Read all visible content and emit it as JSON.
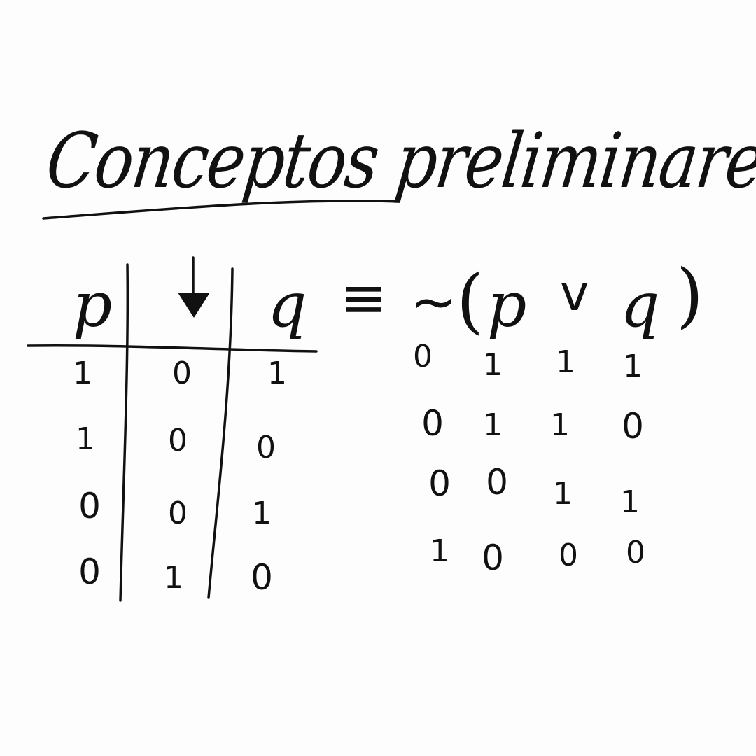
{
  "title": "Conceptos preliminares",
  "truth_table": {
    "headers": [
      "p",
      "↓",
      "q"
    ],
    "rows": [
      [
        "1",
        "0",
        "1"
      ],
      [
        "1",
        "0",
        "0"
      ],
      [
        "0",
        "0",
        "1"
      ],
      [
        "0",
        "1",
        "0"
      ]
    ]
  },
  "equivalence": {
    "equiv_symbol": "≡",
    "negation_symbol": "~",
    "open_paren": "(",
    "left_var": "p",
    "or_symbol": "v",
    "right_var": "q",
    "close_paren": ")",
    "rows": [
      [
        "0",
        "1",
        "1",
        "1"
      ],
      [
        "0",
        "1",
        "1",
        "0"
      ],
      [
        "0",
        "0",
        "1",
        "1"
      ],
      [
        "1",
        "0",
        "0",
        "0"
      ]
    ]
  }
}
